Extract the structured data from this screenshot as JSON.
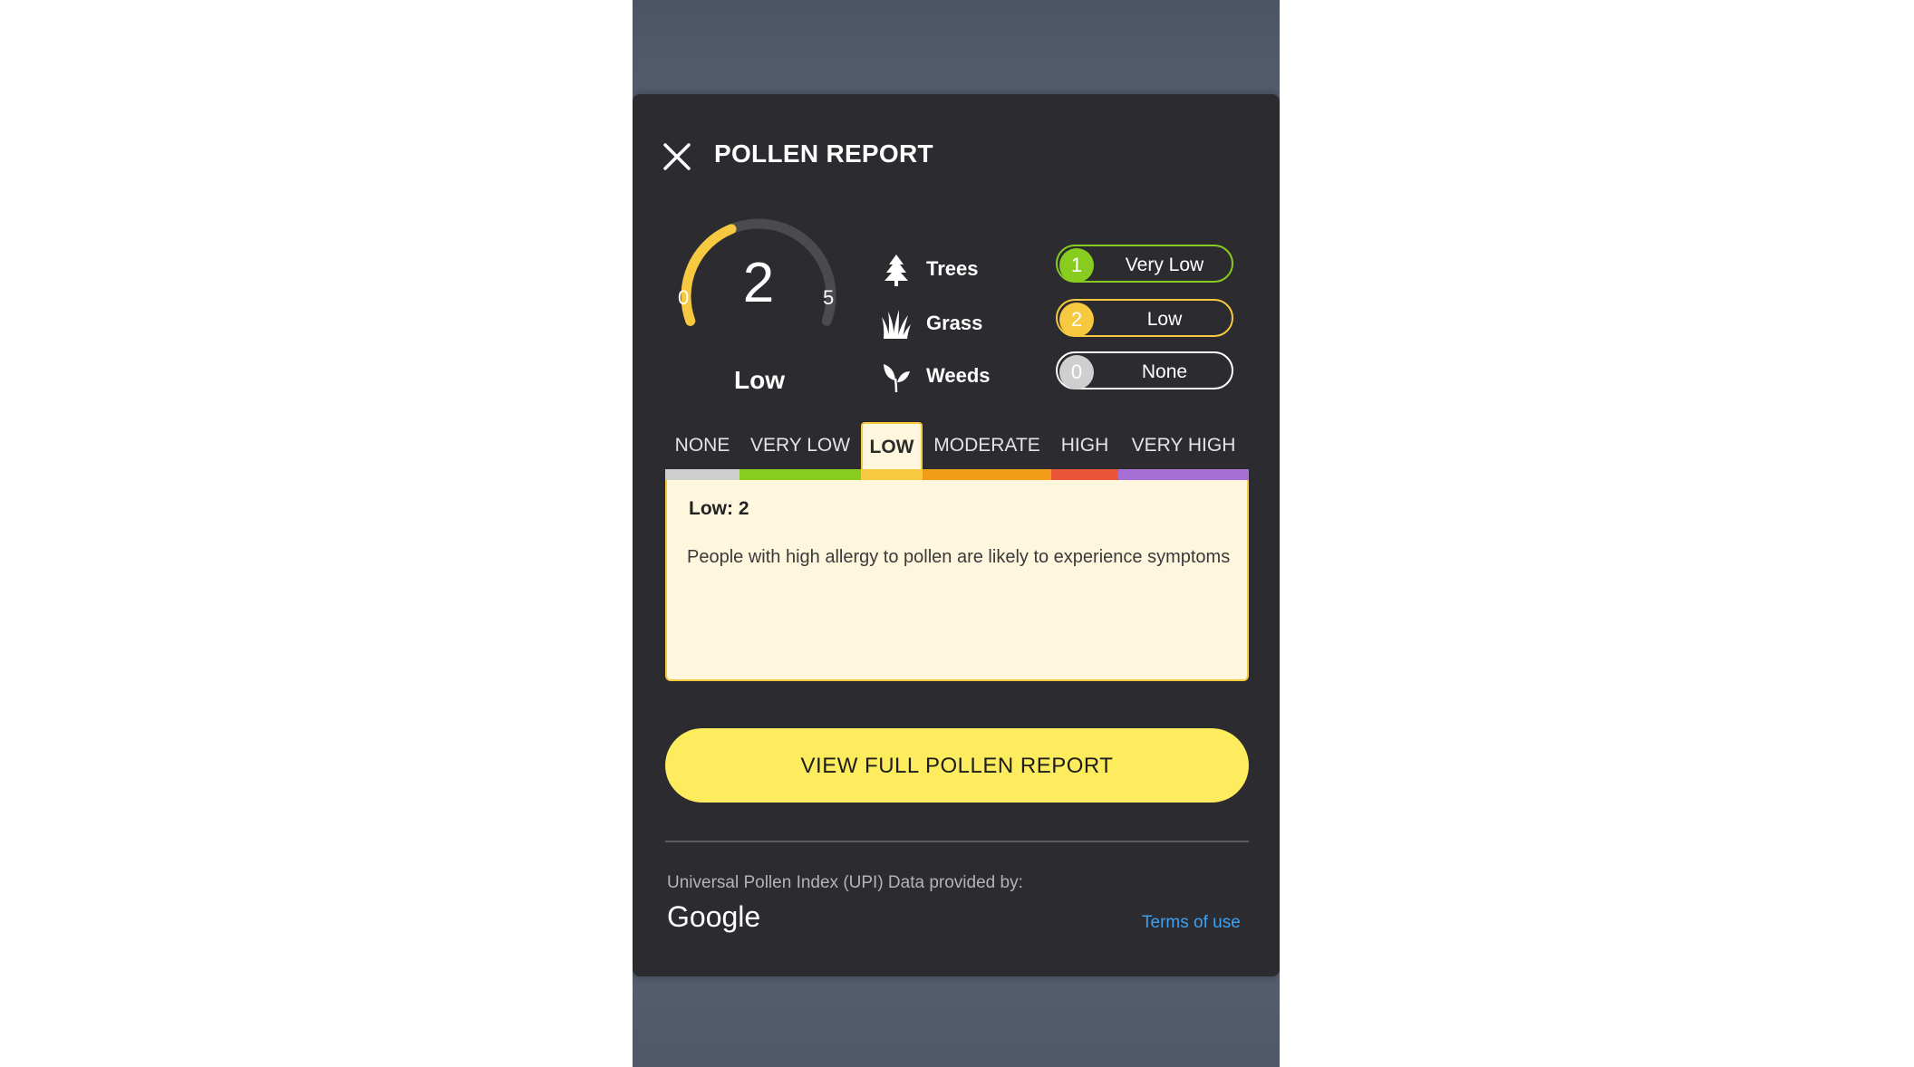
{
  "modal": {
    "title": "POLLEN REPORT"
  },
  "gauge": {
    "value": "2",
    "min": "0",
    "max": "5",
    "level_label": "Low",
    "fill_fraction": 0.4,
    "fill_color": "#f7c941",
    "track_color": "#4a4a4f"
  },
  "pollen_types": [
    {
      "name": "Trees",
      "icon": "tree-icon",
      "index": "1",
      "level": "Very Low",
      "color": "#88cc1f",
      "border": "#88cc1f"
    },
    {
      "name": "Grass",
      "icon": "grass-icon",
      "index": "2",
      "level": "Low",
      "color": "#f7c941",
      "border": "#f7c941"
    },
    {
      "name": "Weeds",
      "icon": "weed-icon",
      "index": "0",
      "level": "None",
      "color": "#cfcfcf",
      "border": "#ffffff"
    }
  ],
  "levels": [
    {
      "label": "NONE",
      "color": "#cfcfcf"
    },
    {
      "label": "VERY LOW",
      "color": "#88cc1f"
    },
    {
      "label": "LOW",
      "color": "#f7c941"
    },
    {
      "label": "MODERATE",
      "color": "#f29d17"
    },
    {
      "label": "HIGH",
      "color": "#eb5538"
    },
    {
      "label": "VERY HIGH",
      "color": "#a66fd6"
    }
  ],
  "selected_level_index": 2,
  "info": {
    "title": "Low: 2",
    "description": "People with high allergy to pollen are likely to experience symptoms"
  },
  "cta": {
    "label": "VIEW FULL POLLEN REPORT"
  },
  "footer": {
    "provided_by": "Universal Pollen Index (UPI) Data provided by:",
    "provider_logo_text": "Google",
    "terms_label": "Terms of use"
  },
  "colors": {
    "modal_bg": "#2c2c30",
    "accent_yellow": "#fdec5d",
    "link_blue": "#3ea0f1"
  }
}
